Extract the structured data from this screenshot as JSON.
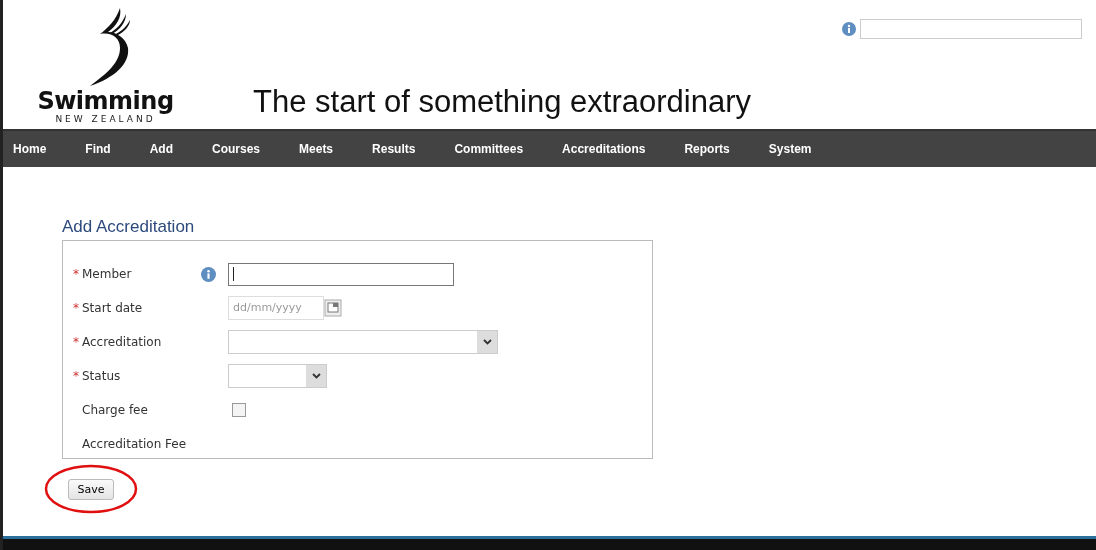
{
  "logo": {
    "name": "Swimming",
    "subtitle": "NEW ZEALAND"
  },
  "tagline": "The start of something extraordinary",
  "search": {
    "kind": "text"
  },
  "nav": [
    "Home",
    "Find",
    "Add",
    "Courses",
    "Meets",
    "Results",
    "Committees",
    "Accreditations",
    "Reports",
    "System"
  ],
  "form": {
    "title": "Add Accreditation",
    "fields": [
      {
        "label": "Member",
        "required_mark": "*",
        "kind": "text",
        "info": true
      },
      {
        "label": "Start date",
        "required_mark": "*",
        "kind": "date",
        "placeholder": "dd/mm/yyyy",
        "info": false
      },
      {
        "label": "Accreditation",
        "required_mark": "*",
        "kind": "select",
        "info": false
      },
      {
        "label": "Status",
        "required_mark": "*",
        "kind": "select-small",
        "info": false
      },
      {
        "label": "Charge fee",
        "kind": "checkbox",
        "checked": false,
        "info": false
      },
      {
        "label": "Accreditation Fee",
        "kind": "plain",
        "info": false
      }
    ]
  },
  "save": {
    "label": "Save",
    "highlighted": true
  }
}
